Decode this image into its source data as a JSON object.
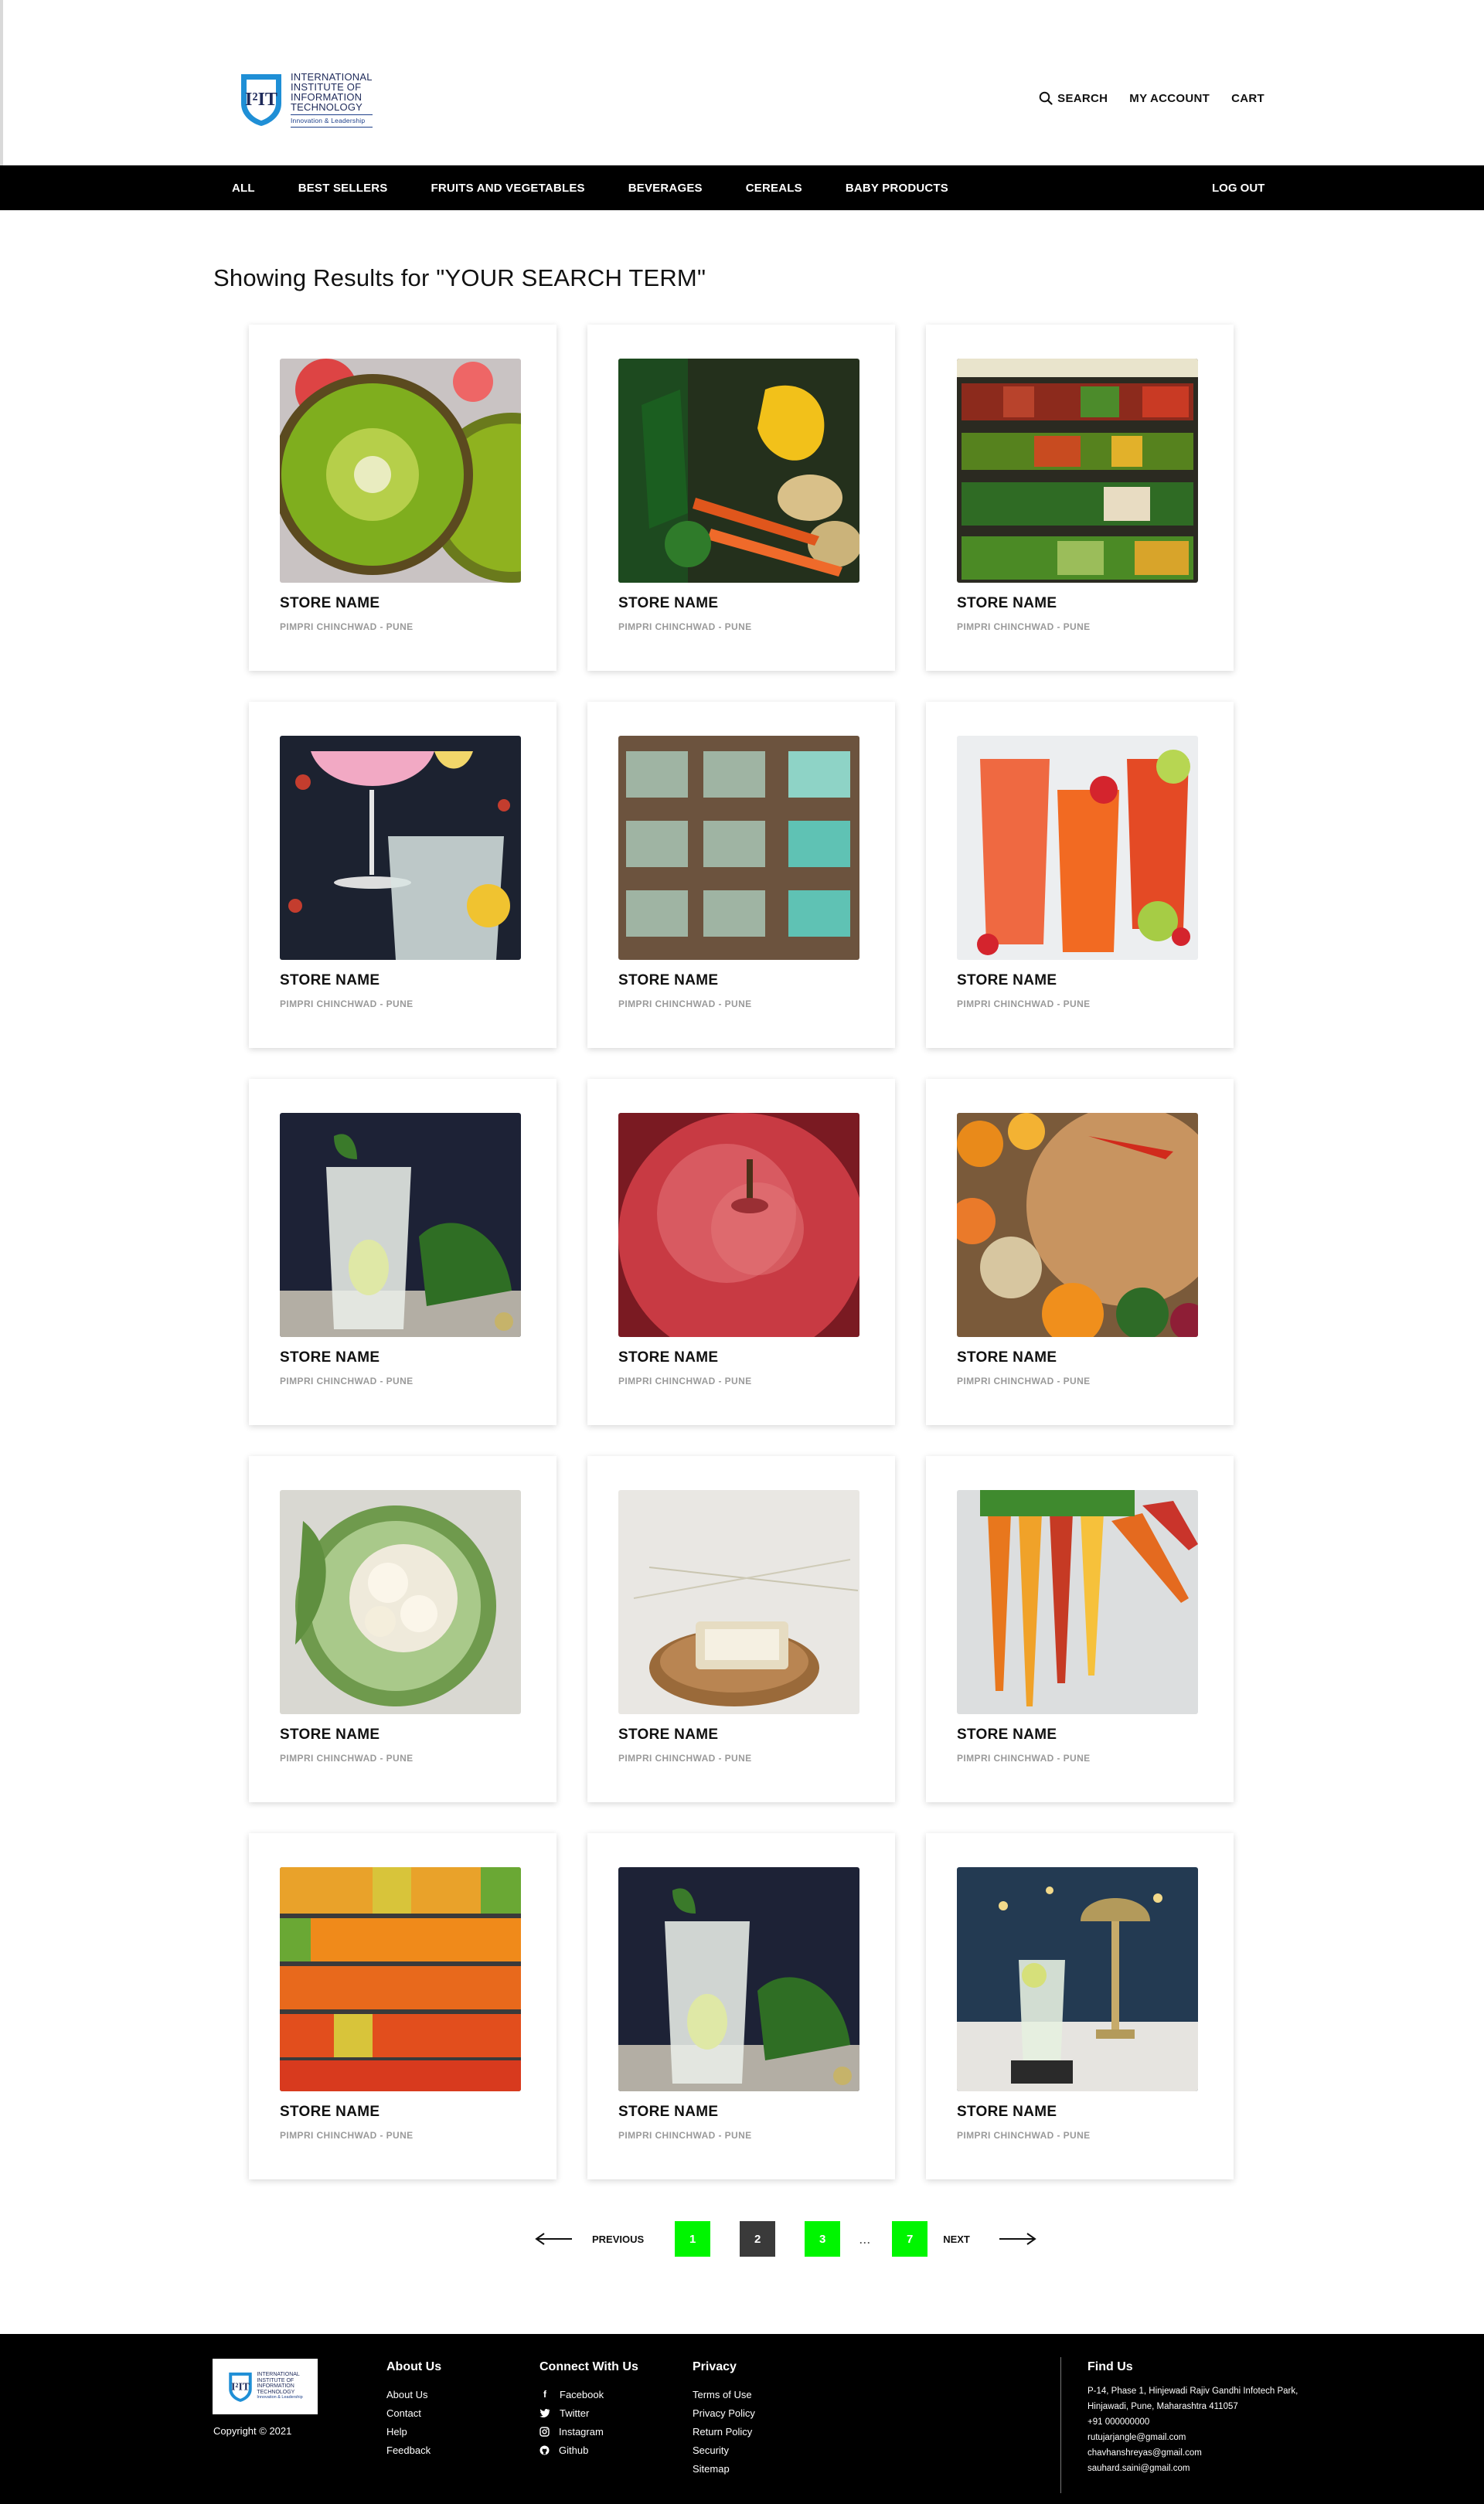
{
  "brand": {
    "logo_lines": [
      "INTERNATIONAL",
      "INSTITUTE OF",
      "INFORMATION",
      "TECHNOLOGY"
    ],
    "tagline": "Innovation & Leadership",
    "colors": {
      "navy": "#1e2a5a",
      "blue": "#1f8fd6",
      "accent_green": "#00f500"
    }
  },
  "header": {
    "search_label": "SEARCH",
    "account_label": "MY ACCOUNT",
    "cart_label": "CART",
    "icons": {
      "search": "search-icon",
      "menu": "kebab-menu-icon"
    }
  },
  "nav": {
    "categories": [
      "ALL",
      "BEST SELLERS",
      "FRUITS AND VEGETABLES",
      "BEVERAGES",
      "CEREALS",
      "BABY PRODUCTS"
    ],
    "logout_label": "LOG OUT"
  },
  "results": {
    "heading": "Showing Results for \"YOUR SEARCH TERM\"",
    "cards": [
      {
        "name": "STORE NAME",
        "location": "PIMPRI CHINCHWAD - PUNE",
        "image": "kiwi"
      },
      {
        "name": "STORE NAME",
        "location": "PIMPRI CHINCHWAD - PUNE",
        "image": "vegetables"
      },
      {
        "name": "STORE NAME",
        "location": "PIMPRI CHINCHWAD - PUNE",
        "image": "produce-shelf"
      },
      {
        "name": "STORE NAME",
        "location": "PIMPRI CHINCHWAD - PUNE",
        "image": "cocktails"
      },
      {
        "name": "STORE NAME",
        "location": "PIMPRI CHINCHWAD - PUNE",
        "image": "soaps"
      },
      {
        "name": "STORE NAME",
        "location": "PIMPRI CHINCHWAD - PUNE",
        "image": "red-drinks"
      },
      {
        "name": "STORE NAME",
        "location": "PIMPRI CHINCHWAD - PUNE",
        "image": "mojito"
      },
      {
        "name": "STORE NAME",
        "location": "PIMPRI CHINCHWAD - PUNE",
        "image": "apple"
      },
      {
        "name": "STORE NAME",
        "location": "PIMPRI CHINCHWAD - PUNE",
        "image": "cutting-board"
      },
      {
        "name": "STORE NAME",
        "location": "PIMPRI CHINCHWAD - PUNE",
        "image": "cauliflower"
      },
      {
        "name": "STORE NAME",
        "location": "PIMPRI CHINCHWAD - PUNE",
        "image": "soap-dish"
      },
      {
        "name": "STORE NAME",
        "location": "PIMPRI CHINCHWAD - PUNE",
        "image": "carrots"
      },
      {
        "name": "STORE NAME",
        "location": "PIMPRI CHINCHWAD - PUNE",
        "image": "fruit-shelves"
      },
      {
        "name": "STORE NAME",
        "location": "PIMPRI CHINCHWAD - PUNE",
        "image": "mojito"
      },
      {
        "name": "STORE NAME",
        "location": "PIMPRI CHINCHWAD - PUNE",
        "image": "lamp-drink"
      }
    ]
  },
  "pagination": {
    "previous_label": "PREVIOUS",
    "next_label": "NEXT",
    "pages": [
      "1",
      "2",
      "3",
      "7"
    ],
    "ellipsis": "...",
    "current_page": "2"
  },
  "footer": {
    "copyright": "Copyright © 2021",
    "about": {
      "title": "About Us",
      "links": [
        "About Us",
        "Contact",
        "Help",
        "Feedback"
      ]
    },
    "connect": {
      "title": "Connect With Us",
      "links": [
        {
          "label": "Facebook",
          "icon": "facebook-icon"
        },
        {
          "label": "Twitter",
          "icon": "twitter-icon"
        },
        {
          "label": "Instagram",
          "icon": "instagram-icon"
        },
        {
          "label": "Github",
          "icon": "github-icon"
        }
      ]
    },
    "privacy": {
      "title": "Privacy",
      "links": [
        "Terms of Use",
        "Privacy Policy",
        "Return Policy",
        "Security",
        "Sitemap"
      ]
    },
    "find_us": {
      "title": "Find Us",
      "lines": [
        "P-14, Phase 1, Hinjewadi Rajiv Gandhi Infotech Park,",
        "Hinjawadi, Pune, Maharashtra 411057",
        "+91 000000000",
        "rutujarjangle@gmail.com",
        "chavhanshreyas@gmail.com",
        "sauhard.saini@gmail.com"
      ]
    }
  }
}
